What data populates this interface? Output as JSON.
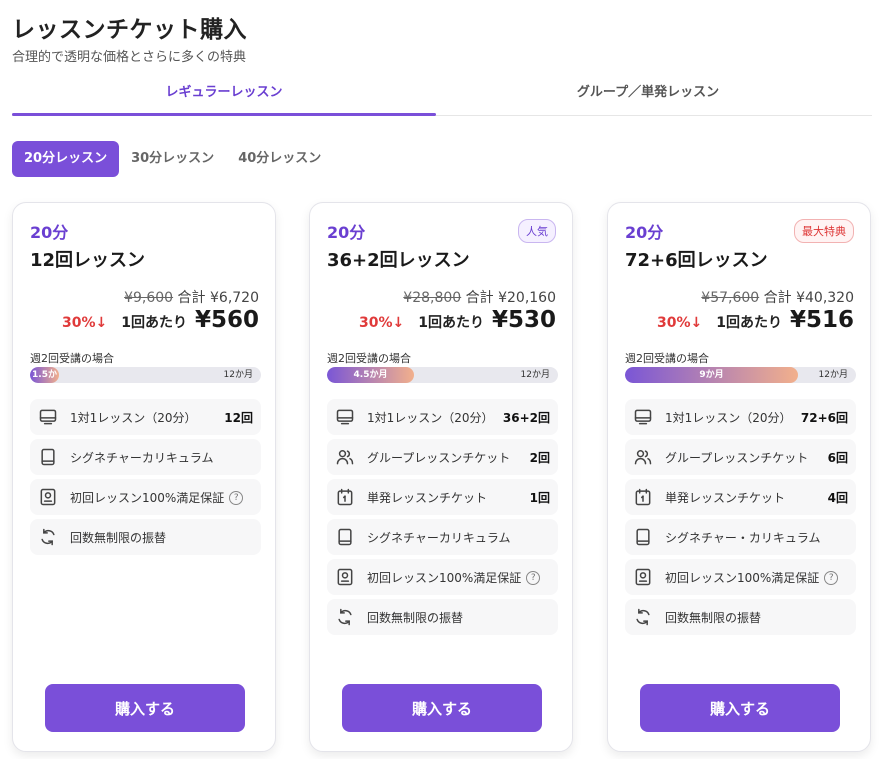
{
  "header": {
    "title": "レッスンチケット購入",
    "subtitle": "合理的で透明な価格とさらに多くの特典"
  },
  "main_tabs": [
    {
      "label": "レギュラーレッスン",
      "active": true
    },
    {
      "label": "グループ／単発レッスン",
      "active": false
    }
  ],
  "duration_tabs": [
    {
      "label": "20分レッスン",
      "active": true
    },
    {
      "label": "30分レッスン",
      "active": false
    },
    {
      "label": "40分レッスン",
      "active": false
    }
  ],
  "colors": {
    "accent": "#7a4fd9",
    "discount": "#e03a3a"
  },
  "plans": [
    {
      "duration": "20分",
      "name": "12回レッスン",
      "badge": "",
      "original_price": "¥9,600",
      "total_label": "合計",
      "total_price": "¥6,720",
      "discount": "30%↓",
      "per_label": "1回あたり",
      "unit_price": "¥560",
      "freq_label": "週2回受講の場合",
      "progress_label": "1.5か月",
      "progress_end": "12か月",
      "progress_fraction": 0.125,
      "buy_label": "購入する",
      "features": [
        {
          "icon": "monitor-icon",
          "label": "1対1レッスン（20分）",
          "value": "12回",
          "help": ""
        },
        {
          "icon": "book-icon",
          "label": "シグネチャーカリキュラム",
          "value": "",
          "help": ""
        },
        {
          "icon": "certificate-icon",
          "label": "初回レッスン100%満足保証",
          "value": "",
          "help": "?"
        },
        {
          "icon": "refresh-icon",
          "label": "回数無制限の振替",
          "value": "",
          "help": ""
        }
      ]
    },
    {
      "duration": "20分",
      "name": "36+2回レッスン",
      "badge": "人気",
      "original_price": "¥28,800",
      "total_label": "合計",
      "total_price": "¥20,160",
      "discount": "30%↓",
      "per_label": "1回あたり",
      "unit_price": "¥530",
      "freq_label": "週2回受講の場合",
      "progress_label": "4.5か月",
      "progress_end": "12か月",
      "progress_fraction": 0.375,
      "buy_label": "購入する",
      "features": [
        {
          "icon": "monitor-icon",
          "label": "1対1レッスン（20分）",
          "value": "36+2回",
          "help": ""
        },
        {
          "icon": "group-icon",
          "label": "グループレッスンチケット",
          "value": "2回",
          "help": ""
        },
        {
          "icon": "calendar-icon",
          "label": "単発レッスンチケット",
          "value": "1回",
          "help": ""
        },
        {
          "icon": "book-icon",
          "label": "シグネチャーカリキュラム",
          "value": "",
          "help": ""
        },
        {
          "icon": "certificate-icon",
          "label": "初回レッスン100%満足保証",
          "value": "",
          "help": "?"
        },
        {
          "icon": "refresh-icon",
          "label": "回数無制限の振替",
          "value": "",
          "help": ""
        }
      ]
    },
    {
      "duration": "20分",
      "name": "72+6回レッスン",
      "badge": "最大特典",
      "original_price": "¥57,600",
      "total_label": "合計",
      "total_price": "¥40,320",
      "discount": "30%↓",
      "per_label": "1回あたり",
      "unit_price": "¥516",
      "freq_label": "週2回受講の場合",
      "progress_label": "9か月",
      "progress_end": "12か月",
      "progress_fraction": 0.75,
      "buy_label": "購入する",
      "features": [
        {
          "icon": "monitor-icon",
          "label": "1対1レッスン（20分）",
          "value": "72+6回",
          "help": ""
        },
        {
          "icon": "group-icon",
          "label": "グループレッスンチケット",
          "value": "6回",
          "help": ""
        },
        {
          "icon": "calendar-icon",
          "label": "単発レッスンチケット",
          "value": "4回",
          "help": ""
        },
        {
          "icon": "book-icon",
          "label": "シグネチャー・カリキュラム",
          "value": "",
          "help": ""
        },
        {
          "icon": "certificate-icon",
          "label": "初回レッスン100%満足保証",
          "value": "",
          "help": "?"
        },
        {
          "icon": "refresh-icon",
          "label": "回数無制限の振替",
          "value": "",
          "help": ""
        }
      ]
    }
  ]
}
